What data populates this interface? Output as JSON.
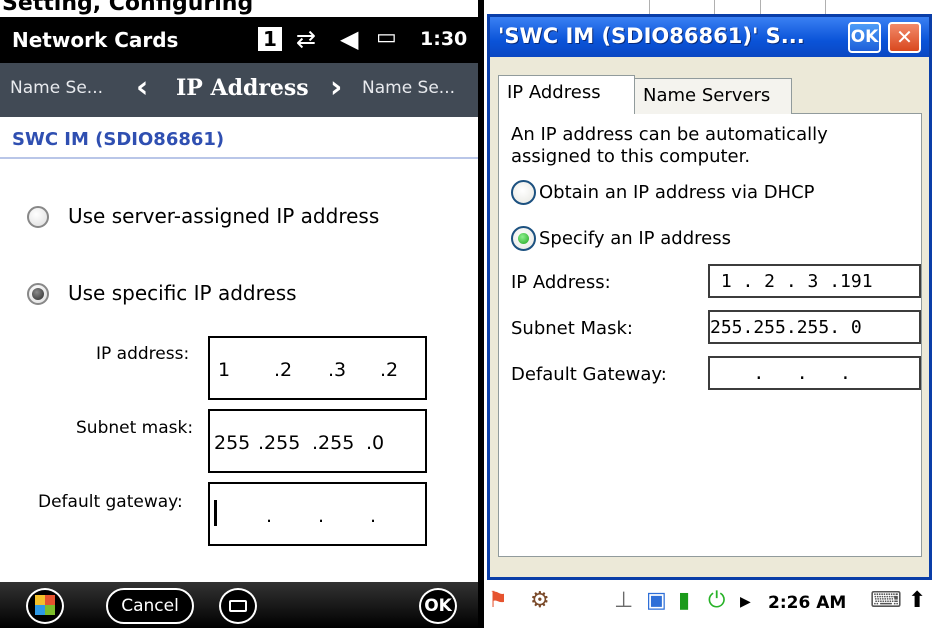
{
  "left": {
    "cropped_title": "Setting, Configuring",
    "status_bar": {
      "title": "Network Cards",
      "signal": "1",
      "icons": [
        "connection-icon",
        "speaker-icon",
        "battery-icon"
      ],
      "time": "1:30"
    },
    "nav": {
      "prev": "Name Se...",
      "current": "IP Address",
      "next": "Name Se..."
    },
    "adapter": "SWC IM (SDIO86861)",
    "options": [
      {
        "label": "Use server-assigned IP address",
        "selected": false
      },
      {
        "label": "Use specific IP address",
        "selected": true
      }
    ],
    "fields": {
      "ip_label": "IP address:",
      "ip_octets": [
        "1",
        ".2",
        ".3",
        ".2"
      ],
      "mask_label": "Subnet mask:",
      "mask_octets": [
        "255",
        ".255",
        ".255",
        ".0"
      ],
      "gateway_label": "Default gateway:",
      "gateway_octets": [
        "",
        ".",
        ".",
        "."
      ]
    },
    "softkeys": {
      "start": "windows-start-icon",
      "cancel": "Cancel",
      "keyboard": "keyboard-icon",
      "ok": "OK"
    }
  },
  "right": {
    "dialog_title": "'SWC IM (SDIO86861)' S...",
    "ok_label": "OK",
    "close_label": "✕",
    "tabs": [
      {
        "label": "IP Address",
        "active": true
      },
      {
        "label": "Name Servers",
        "active": false
      }
    ],
    "intro_line1": "An IP address can be automatically",
    "intro_line2": "assigned to this computer.",
    "options": [
      {
        "label": "Obtain an IP address via DHCP",
        "selected": false
      },
      {
        "label": "Specify an IP address",
        "selected": true
      }
    ],
    "fields": {
      "ip_label": "IP Address:",
      "ip_value": " 1 . 2 . 3 .191",
      "mask_label": "Subnet Mask:",
      "mask_value": "255.255.255. 0",
      "gateway_label": "Default Gateway:",
      "gateway_value": "    .   .   ."
    },
    "taskbar": {
      "time": "2:26 AM",
      "icons": [
        "start-flag-icon",
        "tools-icon",
        "network-icon",
        "wifi-monitor-icon",
        "signal-bars-icon",
        "power-icon",
        "expand-arrow-icon",
        "input-panel-icon",
        "scroll-up-icon"
      ]
    }
  }
}
